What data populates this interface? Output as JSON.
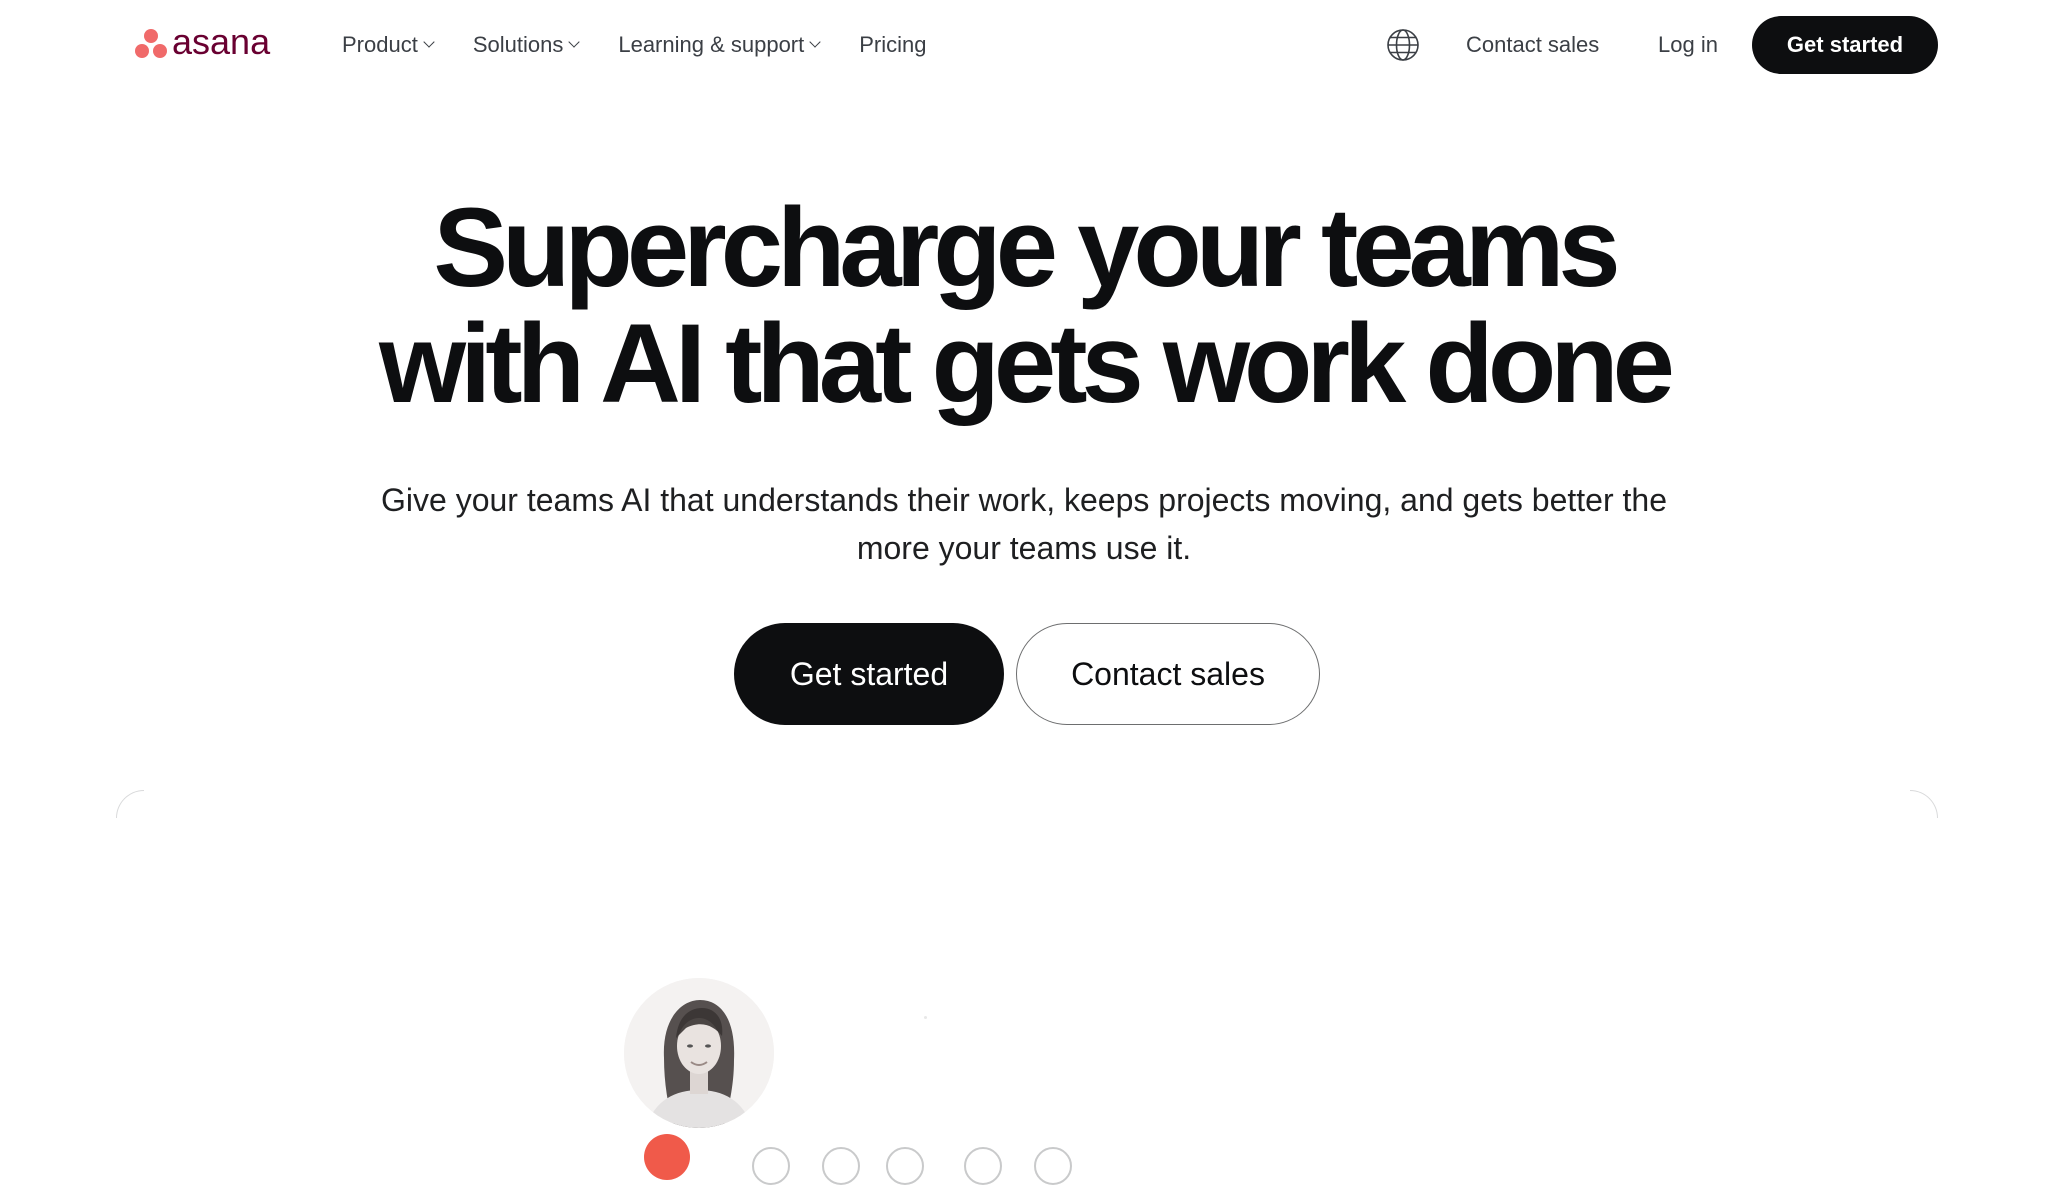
{
  "brand": {
    "name": "asana",
    "logo_color": "#690031",
    "dot_color": "#f06a6a"
  },
  "nav": {
    "items": [
      {
        "label": "Product",
        "has_dropdown": true
      },
      {
        "label": "Solutions",
        "has_dropdown": true
      },
      {
        "label": "Learning & support",
        "has_dropdown": true
      },
      {
        "label": "Pricing",
        "has_dropdown": false
      }
    ],
    "language_icon": "globe-icon",
    "contact_sales": "Contact sales",
    "log_in": "Log in",
    "get_started": "Get started"
  },
  "hero": {
    "title_line_1": "Supercharge your teams",
    "title_line_2": "with AI that gets work done",
    "subtitle": "Give your teams AI that understands their work, keeps projects moving, and gets better the more your teams use it.",
    "primary_cta": "Get started",
    "secondary_cta": "Contact sales"
  },
  "colors": {
    "text_primary": "#0d0e10",
    "button_dark": "#0d0e10",
    "accent_red": "#f05a4a"
  }
}
